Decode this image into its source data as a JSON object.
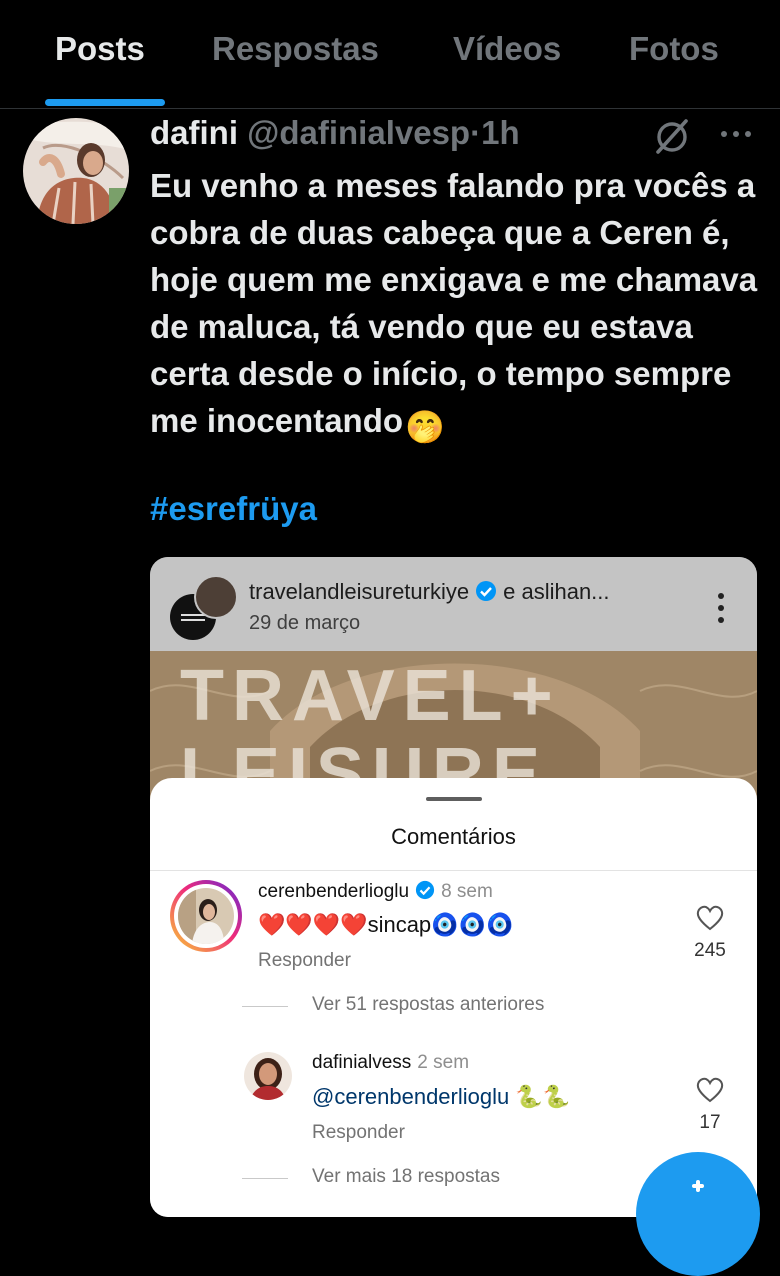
{
  "tabs": [
    {
      "label": "Posts",
      "active": true
    },
    {
      "label": "Respostas",
      "active": false
    },
    {
      "label": "Vídeos",
      "active": false
    },
    {
      "label": "Fotos",
      "active": false
    }
  ],
  "post": {
    "display_name": "dafini",
    "handle": "@dafinialvesp",
    "separator": "·",
    "time": "1h",
    "text": "Eu venho a meses falando pra vocês a cobra de duas cabeça que a Ceren é, hoje quem me enxigava e me chamava de maluca, tá vendo que eu estava certa desde o início, o tempo sempre me inocentando",
    "emoji": "🤭",
    "hashtag": "#esrefrüya"
  },
  "embedded": {
    "ig_user": "travelandleisureturkiye",
    "ig_coauthor": "e aslihan...",
    "ig_date": "29 de março",
    "brand_lines": [
      "TRAVEL+",
      "LEISURE"
    ],
    "sheet_title": "Comentários",
    "comments": [
      {
        "user": "cerenbenderlioglu",
        "time": "8 sem",
        "text_hearts": "❤️❤️❤️❤️",
        "text_word": "sincap",
        "text_after": "🧿🧿🧿",
        "reply_label": "Responder",
        "likes": "245"
      },
      {
        "user": "dafinialvess",
        "time": "2 sem",
        "mention": "@cerenbenderlioglu",
        "text_after": "🐍🐍",
        "reply_label": "Responder",
        "likes": "17"
      }
    ],
    "view_previous": "Ver 51 respostas anteriores",
    "view_more": "Ver mais 18 respostas"
  },
  "colors": {
    "accent": "#1d9bf0",
    "background": "#000000",
    "secondary_text": "#71767b",
    "ig_verified": "#0095f6"
  },
  "icons": [
    "grok-icon",
    "more-options-icon",
    "verified-badge-icon",
    "heart-icon",
    "compose-icon"
  ]
}
